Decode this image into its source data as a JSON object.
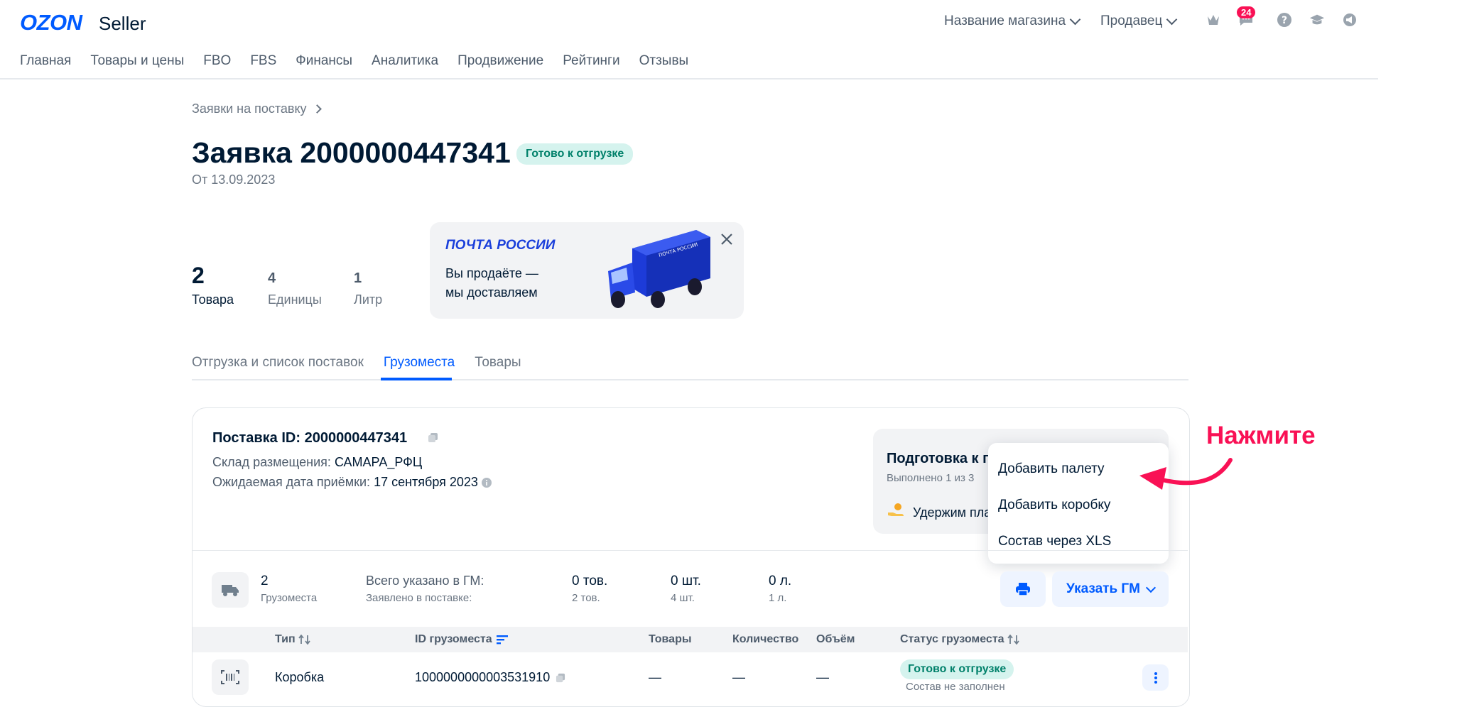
{
  "header": {
    "logo_main": "OZON",
    "logo_sub": "Seller",
    "store_dropdown": "Название магазина",
    "role_dropdown": "Продавец",
    "notifications_count": "24",
    "icons": [
      "crown-icon",
      "chat-icon",
      "help-icon",
      "education-icon",
      "announcement-icon"
    ]
  },
  "nav": {
    "items": [
      "Главная",
      "Товары и цены",
      "FBO",
      "FBS",
      "Финансы",
      "Аналитика",
      "Продвижение",
      "Рейтинги",
      "Отзывы"
    ]
  },
  "breadcrumb": {
    "label": "Заявки на поставку"
  },
  "page": {
    "title": "Заявка 2000000447341",
    "status": "Готово к отгрузке",
    "date": "От 13.09.2023"
  },
  "stats": {
    "items_value": "2",
    "items_label": "Товара",
    "units_value": "4",
    "units_label": "Единицы",
    "liters_value": "1",
    "liters_label": "Литр"
  },
  "banner": {
    "brand": "ПОЧТА РОССИИ",
    "line1": "Вы продаёте —",
    "line2": "мы доставляем",
    "truck_text": "ПОЧТА РОССИИ"
  },
  "tabs": [
    "Отгрузка и список поставок",
    "Грузоместа",
    "Товары"
  ],
  "shipment": {
    "id_label": "Поставка ID: 2000000447341",
    "warehouse_label": "Склад размещения:",
    "warehouse_value": "САМАРА_РФЦ",
    "date_label": "Ожидаемая дата приёмки:",
    "date_value": "17 сентября 2023"
  },
  "prep": {
    "title": "Подготовка к п",
    "progress": "Выполнено 1 из 3",
    "item": "Удержим пла"
  },
  "dropdown": {
    "items": [
      "Добавить палету",
      "Добавить коробку",
      "Состав через XLS"
    ]
  },
  "summary": {
    "count": "2",
    "count_label": "Грузоместа",
    "total_label": "Всего указано в ГМ:",
    "declared_label": "Заявлено в поставке:",
    "goods": "0 тов.",
    "goods_declared": "2 тов.",
    "pcs": "0 шт.",
    "pcs_declared": "4 шт.",
    "liters": "0 л.",
    "liters_declared": "1 л.",
    "specify_button": "Указать ГМ"
  },
  "table": {
    "headers": [
      "Тип",
      "ID грузоместа",
      "Товары",
      "Количество",
      "Объём",
      "Статус грузоместа"
    ],
    "rows": [
      {
        "type": "Коробка",
        "id": "1000000000003531910",
        "goods": "—",
        "qty": "—",
        "volume": "—",
        "status": "Готово к отгрузке",
        "status_sub": "Состав не заполнен"
      }
    ]
  },
  "annotation": "Нажмите",
  "colors": {
    "accent": "#005bff",
    "annotation": "#f91155",
    "success_bg": "#d5f3ee",
    "success_text": "#00806a"
  }
}
